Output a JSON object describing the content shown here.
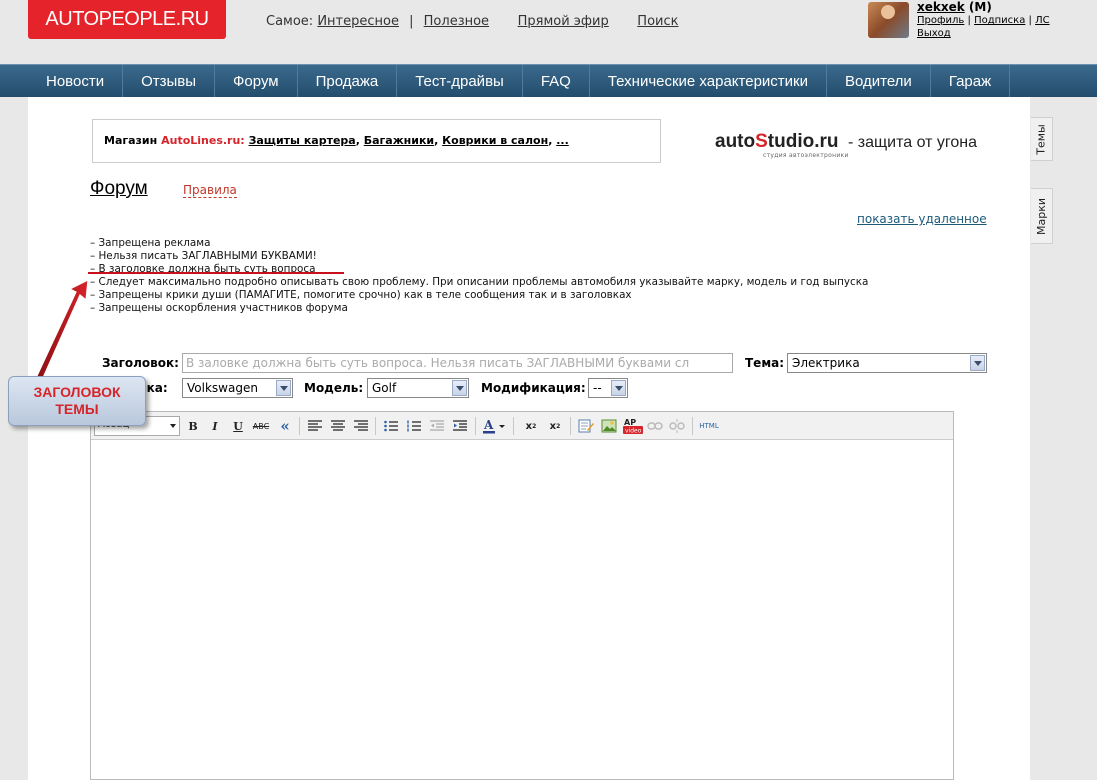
{
  "header": {
    "logo": "AUTOPEOPLE.RU",
    "topnav_prefix": "Самое:",
    "topnav": [
      "Интересное",
      "Полезное",
      "Прямой эфир",
      "Поиск"
    ],
    "user": {
      "name": "xekxek",
      "gender": "(M)",
      "links": [
        "Профиль",
        "Подписка",
        "ЛС",
        "Выход"
      ]
    }
  },
  "mainnav": [
    "Новости",
    "Отзывы",
    "Форум",
    "Продажа",
    "Тест-драйвы",
    "FAQ",
    "Технические характеристики",
    "Водители",
    "Гараж"
  ],
  "side_tabs": [
    "Темы",
    "Марки"
  ],
  "ad": {
    "prefix": "Магазин",
    "shop": "AutoLines.ru:",
    "links": [
      "Защиты картера",
      "Багажники",
      "Коврики в салон",
      "..."
    ],
    "brand_auto": "auto",
    "brand_s": "S",
    "brand_rest": "tudio.ru",
    "brand_sub": "студия автоэлектроники",
    "tagline": "- защита от угона"
  },
  "page": {
    "title": "Форум",
    "rules_link": "Правила",
    "show_deleted": "показать удаленное",
    "rules": [
      "– Запрещена реклама",
      "– Нельзя писать ЗАГЛАВНЫМИ БУКВАМИ!",
      "– В заголовке должна быть суть вопроса",
      "– Следует максимально подробно описывать свою проблему. При описании проблемы автомобиля указывайте марку, модель и год выпуска",
      "– Запрещены крики души (ПАМАГИТЕ, помогите срочно) как в теле сообщения так и в заголовках",
      "– Запрещены оскорбления участников форума"
    ]
  },
  "annotation": {
    "line1": "ЗАГОЛОВОК",
    "line2": "ТЕМЫ"
  },
  "form": {
    "title_label": "Заголовок:",
    "title_placeholder": "В заловке должна быть суть вопроса. Нельзя писать ЗАГЛАВНЫМИ буквами сл",
    "topic_label": "Тема:",
    "topic_value": "Электрика",
    "brand_label": "Марка:",
    "brand_value": "Volkswagen",
    "model_label": "Модель:",
    "model_value": "Golf",
    "mod_label": "Модификация:",
    "mod_value": "--"
  },
  "editor": {
    "format_value": "Абзац",
    "buttons": [
      "B",
      "I",
      "U",
      "ABC",
      "«",
      "align-left-icon",
      "align-center-icon",
      "align-right-icon",
      "bullet-list-icon",
      "numbered-list-icon",
      "outdent-icon",
      "indent-icon",
      "text-color-icon",
      "subscript-icon",
      "superscript-icon",
      "edit-icon",
      "image-icon",
      "video-icon",
      "link-icon",
      "unlink-icon",
      "HTML"
    ],
    "html_label": "HTML",
    "video_label": "AP"
  },
  "colors": {
    "accent_red": "#e5232a",
    "nav_blue": "#2c5878",
    "link_blue": "#1d5a7a"
  }
}
